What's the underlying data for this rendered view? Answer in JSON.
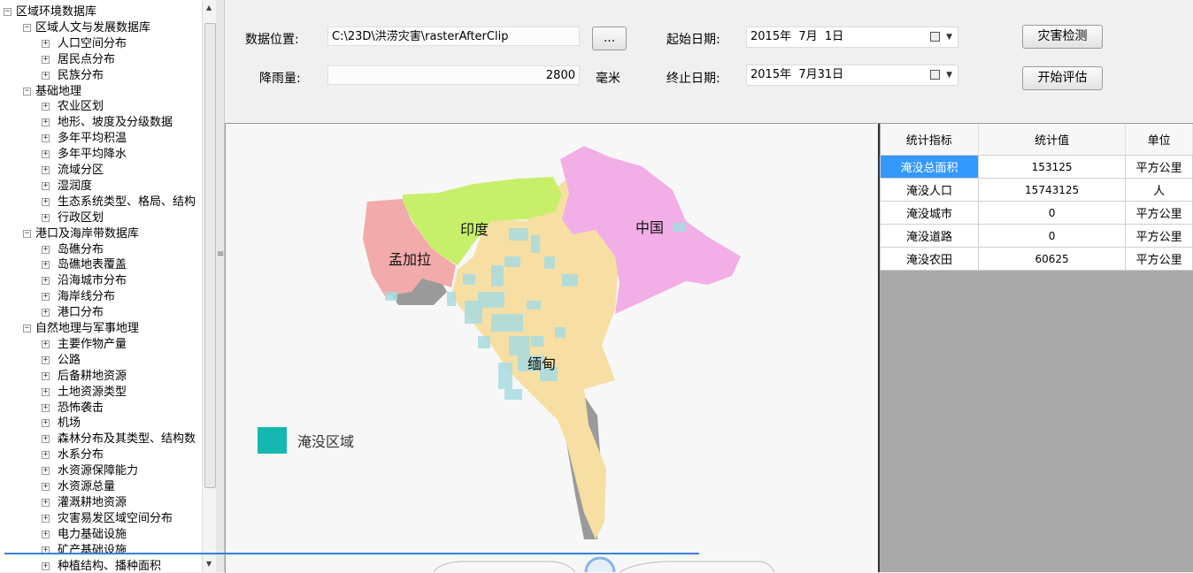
{
  "tree": {
    "nodes": [
      {
        "label": "区域环境数据库",
        "level": 0,
        "expanded": true
      },
      {
        "label": "区域人文与发展数据库",
        "level": 1,
        "expanded": true
      },
      {
        "label": "人口空间分布",
        "level": 2,
        "expanded": false
      },
      {
        "label": "居民点分布",
        "level": 2,
        "expanded": false
      },
      {
        "label": "民族分布",
        "level": 2,
        "expanded": false
      },
      {
        "label": "基础地理",
        "level": 1,
        "expanded": true
      },
      {
        "label": "农业区划",
        "level": 2,
        "expanded": false
      },
      {
        "label": "地形、坡度及分级数据",
        "level": 2,
        "expanded": false
      },
      {
        "label": "多年平均积温",
        "level": 2,
        "expanded": false
      },
      {
        "label": "多年平均降水",
        "level": 2,
        "expanded": false
      },
      {
        "label": "流域分区",
        "level": 2,
        "expanded": false
      },
      {
        "label": "湿润度",
        "level": 2,
        "expanded": false
      },
      {
        "label": "生态系统类型、格局、结构",
        "level": 2,
        "expanded": false
      },
      {
        "label": "行政区划",
        "level": 2,
        "expanded": false
      },
      {
        "label": "港口及海岸带数据库",
        "level": 1,
        "expanded": true
      },
      {
        "label": "岛礁分布",
        "level": 2,
        "expanded": false
      },
      {
        "label": "岛礁地表覆盖",
        "level": 2,
        "expanded": false
      },
      {
        "label": "沿海城市分布",
        "level": 2,
        "expanded": false
      },
      {
        "label": "海岸线分布",
        "level": 2,
        "expanded": false
      },
      {
        "label": "港口分布",
        "level": 2,
        "expanded": false
      },
      {
        "label": "自然地理与军事地理",
        "level": 1,
        "expanded": true
      },
      {
        "label": "主要作物产量",
        "level": 2,
        "expanded": false
      },
      {
        "label": "公路",
        "level": 2,
        "expanded": false
      },
      {
        "label": "后备耕地资源",
        "level": 2,
        "expanded": false
      },
      {
        "label": "土地资源类型",
        "level": 2,
        "expanded": false
      },
      {
        "label": "恐怖袭击",
        "level": 2,
        "expanded": false
      },
      {
        "label": "机场",
        "level": 2,
        "expanded": false
      },
      {
        "label": "森林分布及其类型、结构数",
        "level": 2,
        "expanded": false
      },
      {
        "label": "水系分布",
        "level": 2,
        "expanded": false
      },
      {
        "label": "水资源保障能力",
        "level": 2,
        "expanded": false
      },
      {
        "label": "水资源总量",
        "level": 2,
        "expanded": false
      },
      {
        "label": "灌溉耕地资源",
        "level": 2,
        "expanded": false
      },
      {
        "label": "灾害易发区域空间分布",
        "level": 2,
        "expanded": false
      },
      {
        "label": "电力基础设施",
        "level": 2,
        "expanded": false
      },
      {
        "label": "矿产基础设施",
        "level": 2,
        "expanded": false
      },
      {
        "label": "种植结构、播种面积",
        "level": 2,
        "expanded": false
      }
    ]
  },
  "form": {
    "data_location_label": "数据位置:",
    "data_location_value": "C:\\23D\\洪涝灾害\\rasterAfterClip",
    "browse_label": "...",
    "rainfall_label": "降雨量:",
    "rainfall_value": "2800",
    "rainfall_unit": "毫米",
    "start_date_label": "起始日期:",
    "start_date_value": "2015年  7月  1日",
    "end_date_label": "终止日期:",
    "end_date_value": "2015年  7月31日",
    "detect_button": "灾害检测",
    "assess_button": "开始评估"
  },
  "map": {
    "labels": {
      "india": "印度",
      "china": "中国",
      "bangladesh": "孟加拉",
      "myanmar": "缅甸"
    },
    "legend_label": "淹没区域",
    "flood_color": "#14b8b0",
    "colors": {
      "india": "#c8ef6a",
      "china": "#f2aee6",
      "bangladesh": "#f2aaaa",
      "myanmar": "#f7dfa3",
      "flood_overlay": "#a8dce0"
    }
  },
  "table": {
    "headers": [
      "统计指标",
      "统计值",
      "单位"
    ],
    "rows": [
      {
        "name": "淹没总面积",
        "value": "153125",
        "unit": "平方公里",
        "selected": true
      },
      {
        "name": "淹没人口",
        "value": "15743125",
        "unit": "人",
        "selected": false
      },
      {
        "name": "淹没城市",
        "value": "0",
        "unit": "平方公里",
        "selected": false
      },
      {
        "name": "淹没道路",
        "value": "0",
        "unit": "平方公里",
        "selected": false
      },
      {
        "name": "淹没农田",
        "value": "60625",
        "unit": "平方公里",
        "selected": false
      }
    ]
  }
}
